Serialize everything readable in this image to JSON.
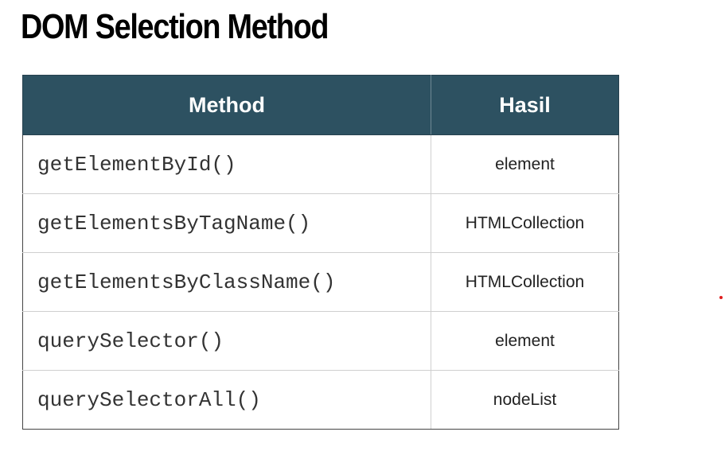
{
  "slide": {
    "title": "DOM Selection Method"
  },
  "table": {
    "headers": {
      "method": "Method",
      "result": "Hasil"
    },
    "rows": [
      {
        "method": "getElementById()",
        "result": "element"
      },
      {
        "method": "getElementsByTagName()",
        "result": "HTMLCollection"
      },
      {
        "method": "getElementsByClassName()",
        "result": "HTMLCollection"
      },
      {
        "method": "querySelector()",
        "result": "element"
      },
      {
        "method": "querySelectorAll()",
        "result": "nodeList"
      }
    ]
  },
  "colors": {
    "header_background": "#2d5161",
    "header_text": "#ffffff",
    "pointer_dot": "#e01e1e"
  }
}
